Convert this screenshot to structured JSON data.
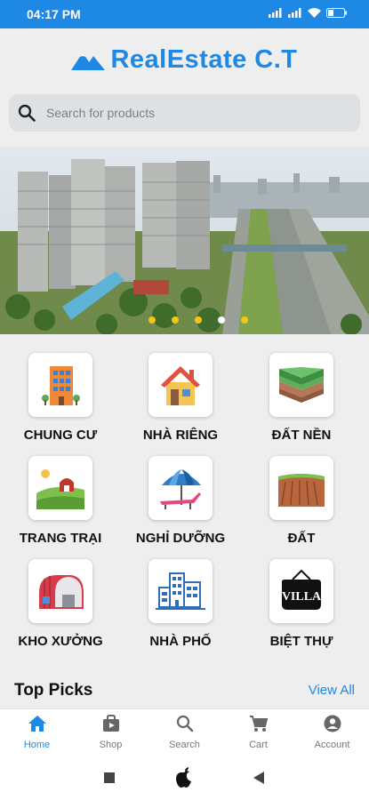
{
  "status_bar": {
    "time": "04:17 PM"
  },
  "app": {
    "title": "RealEstate C.T"
  },
  "search": {
    "placeholder": "Search for products"
  },
  "banner": {
    "dots": 5,
    "active_dot": 3
  },
  "categories": [
    {
      "label": "CHUNG CƯ",
      "icon": "apartment-building-icon"
    },
    {
      "label": "NHÀ RIÊNG",
      "icon": "house-icon"
    },
    {
      "label": "ĐẤT NỀN",
      "icon": "land-layers-icon"
    },
    {
      "label": "TRANG TRẠI",
      "icon": "farm-icon"
    },
    {
      "label": "NGHỈ DƯỠNG",
      "icon": "beach-umbrella-icon"
    },
    {
      "label": "ĐẤT",
      "icon": "soil-field-icon"
    },
    {
      "label": "KHO XƯỞNG",
      "icon": "warehouse-icon"
    },
    {
      "label": "NHÀ PHỐ",
      "icon": "townhouse-icon"
    },
    {
      "label": "BIỆT THỰ",
      "icon": "villa-sign-icon"
    }
  ],
  "sections": {
    "top_picks": "Top Picks",
    "view_all": "View All"
  },
  "bottom_nav": [
    {
      "label": "Home",
      "icon": "home-icon",
      "active": true
    },
    {
      "label": "Shop",
      "icon": "shop-bag-icon",
      "active": false
    },
    {
      "label": "Search",
      "icon": "search-icon",
      "active": false
    },
    {
      "label": "Cart",
      "icon": "cart-icon",
      "active": false
    },
    {
      "label": "Account",
      "icon": "account-icon",
      "active": false
    }
  ],
  "colors": {
    "primary": "#1e88e5",
    "dot": "#f5c518",
    "background": "#eeeeee"
  }
}
